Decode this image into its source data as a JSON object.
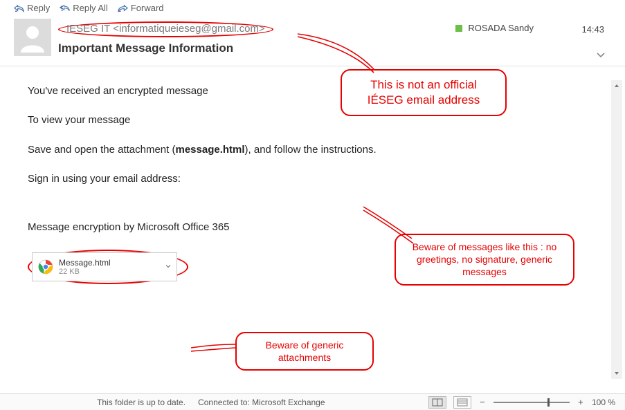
{
  "toolbar": {
    "reply": "Reply",
    "reply_all": "Reply All",
    "forward": "Forward"
  },
  "header": {
    "sender": "IESEG IT <informatiqueieseg@gmail.com>",
    "subject": "Important Message Information",
    "recipient": "ROSADA Sandy",
    "time": "14:43"
  },
  "body": {
    "line1": "You've received an encrypted message",
    "line2": "To view your message",
    "line3a": "Save and open the attachment (",
    "line3b": "message.html",
    "line3c": "), and follow the instructions.",
    "line4": "Sign in using your email address:",
    "line5": "Message encryption by Microsoft Office 365"
  },
  "attachment": {
    "name": "Message.html",
    "size": "22 KB"
  },
  "callouts": {
    "c1": "This is not an official IÉSEG email address",
    "c2": "Beware of messages like this : no greetings, no signature, generic messages",
    "c3": "Beware of generic attachments"
  },
  "statusbar": {
    "folder": "This folder is up to date.",
    "connected": "Connected to: Microsoft Exchange",
    "zoom": "100 %"
  }
}
